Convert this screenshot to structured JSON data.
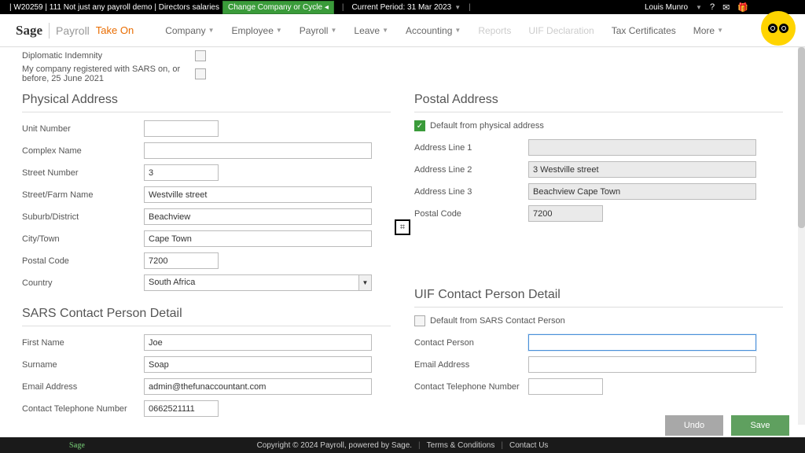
{
  "topbar": {
    "session": "| W20259 | 111 Not just any payroll demo | Directors salaries",
    "change": "Change Company or Cycle ◂",
    "period": "Current Period: 31 Mar 2023",
    "user": "Louis Munro"
  },
  "logo": {
    "sage": "Sage",
    "payroll": "Payroll",
    "takeon": "Take On"
  },
  "nav": [
    {
      "label": "Company",
      "caret": true
    },
    {
      "label": "Employee",
      "caret": true
    },
    {
      "label": "Payroll",
      "caret": true
    },
    {
      "label": "Leave",
      "caret": true
    },
    {
      "label": "Accounting",
      "caret": true
    },
    {
      "label": "Reports",
      "disabled": true
    },
    {
      "label": "UIF Declaration",
      "disabled": true
    },
    {
      "label": "Tax Certificates"
    },
    {
      "label": "More",
      "caret": true
    }
  ],
  "pretext": {
    "diplomatic": "Diplomatic Indemnity",
    "sars": "My company registered with SARS on, or before, 25 June 2021"
  },
  "physical": {
    "title": "Physical Address",
    "unit_number": {
      "label": "Unit Number",
      "value": ""
    },
    "complex": {
      "label": "Complex Name",
      "value": ""
    },
    "street_no": {
      "label": "Street Number",
      "value": "3"
    },
    "street_name": {
      "label": "Street/Farm Name",
      "value": "Westville street"
    },
    "suburb": {
      "label": "Suburb/District",
      "value": "Beachview"
    },
    "city": {
      "label": "City/Town",
      "value": "Cape Town"
    },
    "postal": {
      "label": "Postal Code",
      "value": "7200"
    },
    "country": {
      "label": "Country",
      "value": "South Africa"
    }
  },
  "postal": {
    "title": "Postal Address",
    "default_chk": "Default from physical address",
    "line1": {
      "label": "Address Line 1",
      "value": ""
    },
    "line2": {
      "label": "Address Line 2",
      "value": "3 Westville street"
    },
    "line3": {
      "label": "Address Line 3",
      "value": "Beachview Cape Town"
    },
    "code": {
      "label": "Postal Code",
      "value": "7200"
    }
  },
  "sars": {
    "title": "SARS Contact Person Detail",
    "first": {
      "label": "First Name",
      "value": "Joe"
    },
    "surname": {
      "label": "Surname",
      "value": "Soap"
    },
    "email": {
      "label": "Email Address",
      "value": "admin@thefunaccountant.com"
    },
    "phone": {
      "label": "Contact Telephone Number",
      "value": "0662521111"
    }
  },
  "uif": {
    "title": "UIF Contact Person Detail",
    "default_chk": "Default from SARS Contact Person",
    "contact": {
      "label": "Contact Person",
      "value": ""
    },
    "email": {
      "label": "Email Address",
      "value": ""
    },
    "phone": {
      "label": "Contact Telephone Number",
      "value": ""
    }
  },
  "buttons": {
    "undo": "Undo",
    "save": "Save"
  },
  "footer": {
    "copy": "Copyright © 2024 Payroll, powered by Sage.",
    "terms": "Terms & Conditions",
    "contact": "Contact Us"
  }
}
